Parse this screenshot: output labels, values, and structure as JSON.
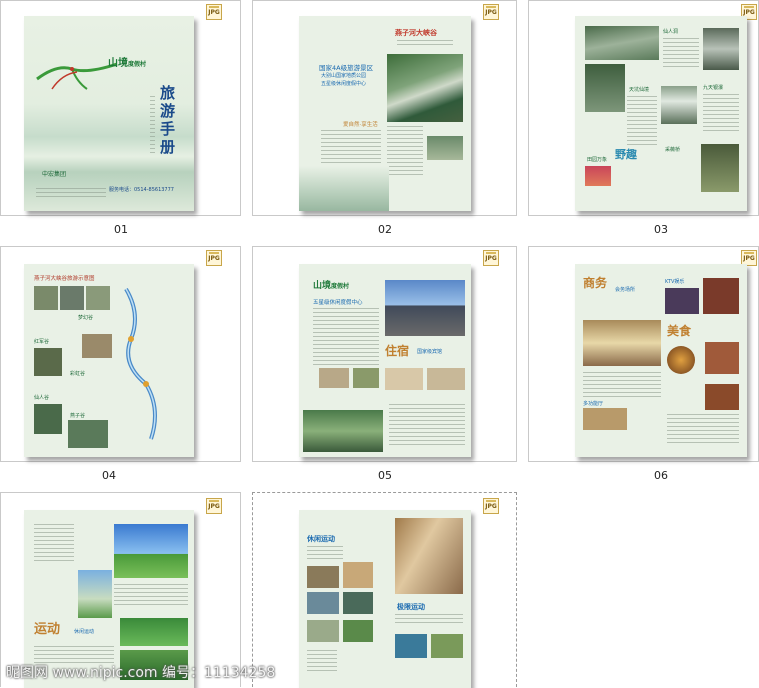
{
  "badge_text": "JPG",
  "thumbnails": [
    {
      "caption": "01"
    },
    {
      "caption": "02"
    },
    {
      "caption": "03"
    },
    {
      "caption": "04"
    },
    {
      "caption": "05"
    },
    {
      "caption": "06"
    },
    {
      "caption": ""
    },
    {
      "caption": ""
    }
  ],
  "page1": {
    "title": "旅游手册",
    "brand": "山境",
    "brand_sub": "度假村",
    "logo": "中宏集团",
    "hotline": "服务电话：0514-85613777"
  },
  "page2": {
    "h1": "国家4A级旅游景区",
    "h2": "大别山国家地质公园",
    "h3": "五星级休闲度假中心",
    "tagline": "爱自然·享生活",
    "logo": "燕子河大峡谷"
  },
  "page3": {
    "labels": [
      "仙人洞",
      "天坑仙境",
      "九天银瀑",
      "采薇桥"
    ],
    "title": "野趣",
    "sub": "田园万象"
  },
  "page4": {
    "header": "燕子河大峡谷旅游示意图",
    "labels": [
      "梦幻谷",
      "红军谷",
      "仙人谷",
      "彩虹谷",
      "燕子谷"
    ]
  },
  "page5": {
    "brand": "山境",
    "brand_sub": "度假村",
    "line": "五星级休闲度假中心",
    "title": "住宿",
    "title_sub": "国家级宾馆"
  },
  "page6": {
    "title1": "商务",
    "sub1": "会务场所",
    "ktv": "KTV娱乐",
    "title2": "美食",
    "room": "多功能厅"
  },
  "page7": {
    "title": "运动",
    "sub": "休闲运动"
  },
  "page8": {
    "h1": "休闲运动",
    "h2": "极限运动"
  },
  "watermark": "昵图网 www.nipic.com  编号：11134258"
}
